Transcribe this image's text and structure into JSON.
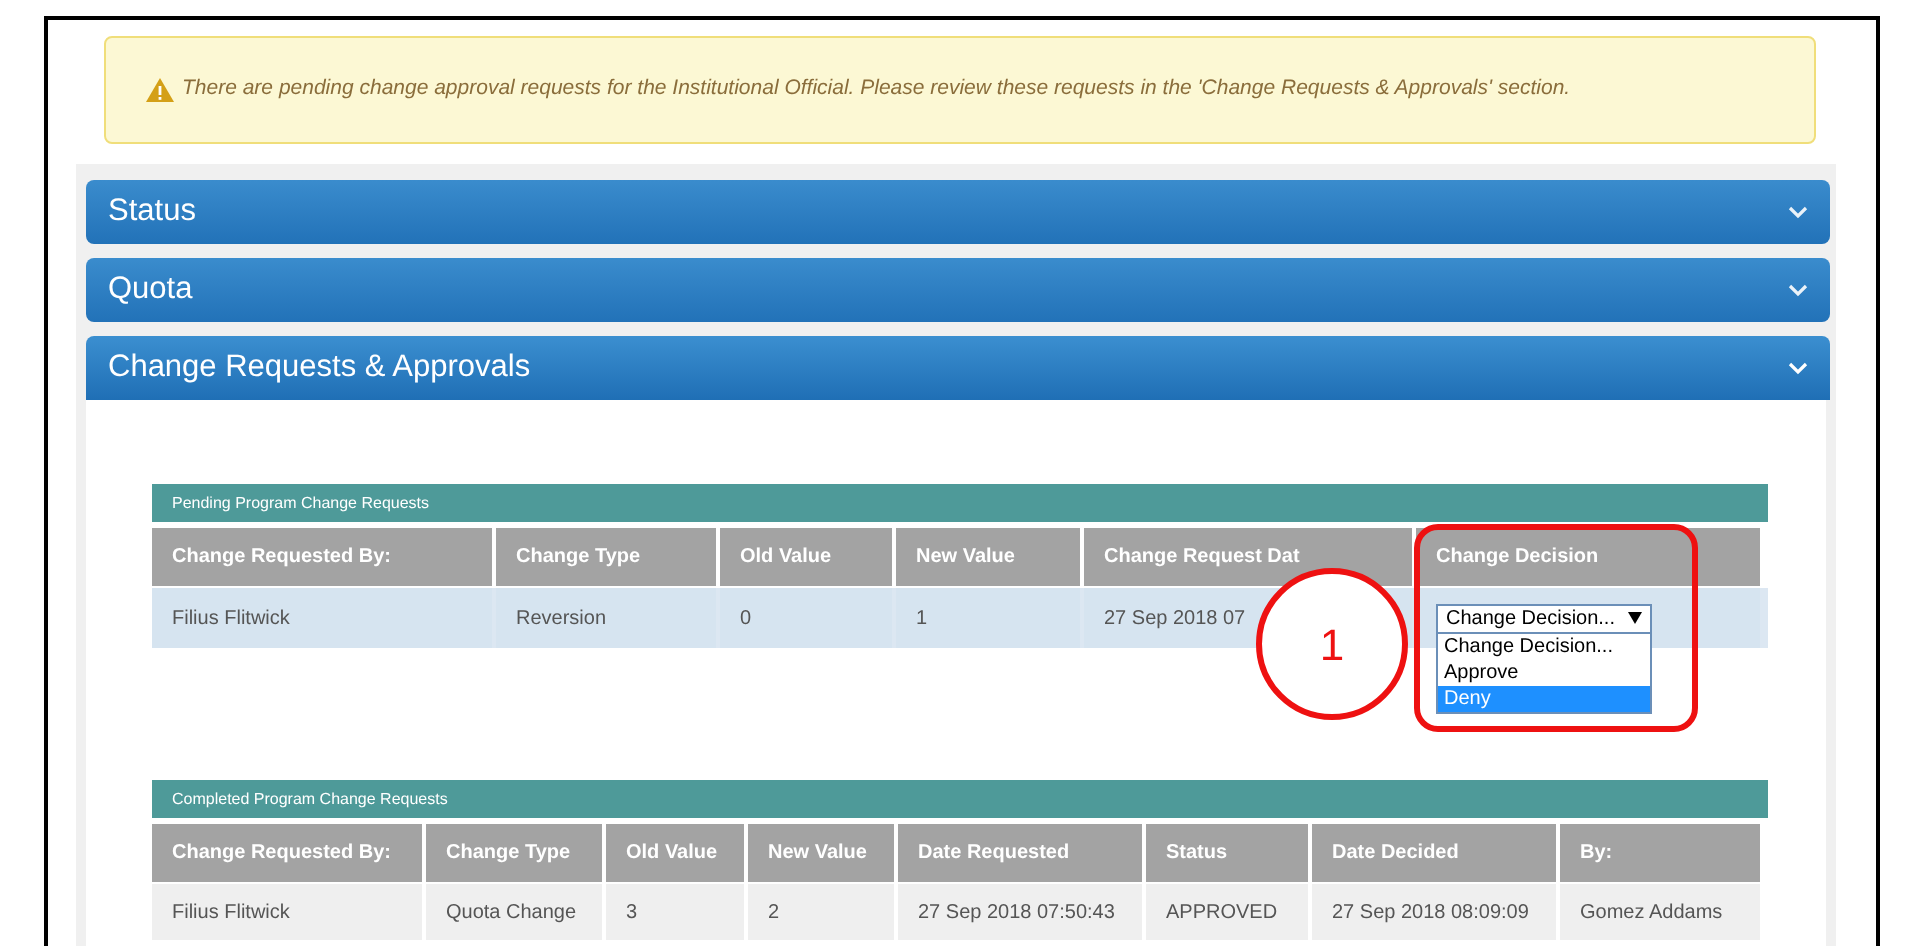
{
  "alert": {
    "text": "There are pending change approval requests for the Institutional Official. Please review these requests in the 'Change Requests & Approvals' section."
  },
  "accordion": [
    {
      "title": "Status",
      "expanded": false
    },
    {
      "title": "Quota",
      "expanded": false
    },
    {
      "title": "Change Requests & Approvals",
      "expanded": true
    }
  ],
  "pending_table": {
    "title": "Pending Program Change Requests",
    "columns": [
      "Change Requested By:",
      "Change Type",
      "Old Value",
      "New Value",
      "Change Request Dat",
      "Change Decision"
    ],
    "rows": [
      {
        "cells": [
          "Filius Flitwick",
          "Reversion",
          "0",
          "1",
          "27 Sep 2018 07"
        ],
        "decision": {
          "value": "Change Decision...",
          "options": [
            {
              "label": "Change Decision...",
              "highlighted": false
            },
            {
              "label": "Approve",
              "highlighted": false
            },
            {
              "label": "Deny",
              "highlighted": true
            }
          ]
        }
      }
    ]
  },
  "completed_table": {
    "title": "Completed Program Change Requests",
    "columns": [
      "Change Requested By:",
      "Change Type",
      "Old Value",
      "New Value",
      "Date Requested",
      "Status",
      "Date Decided",
      "By:"
    ],
    "rows": [
      [
        "Filius Flitwick",
        "Quota Change",
        "3",
        "2",
        "27 Sep 2018 07:50:43",
        "APPROVED",
        "27 Sep 2018 08:09:09",
        "Gomez Addams"
      ]
    ]
  },
  "callout": {
    "number": "1"
  }
}
